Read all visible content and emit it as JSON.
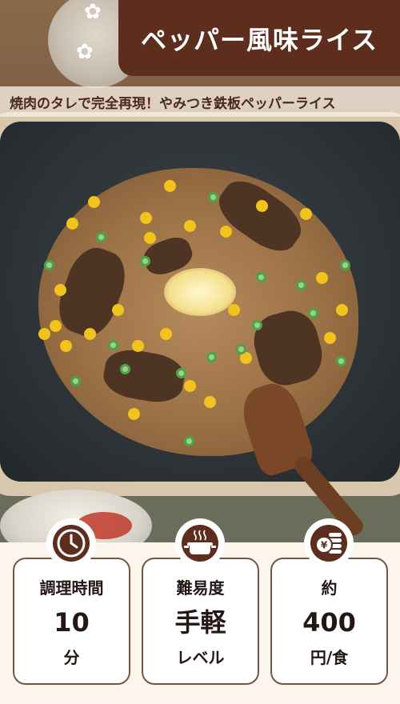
{
  "header": {
    "title": "ペッパー風味ライス",
    "subtitle": "焼肉のタレで完全再現！やみつき鉄板ペッパーライス"
  },
  "info_cards": [
    {
      "icon": "clock-icon",
      "label": "調理時間",
      "value": "10",
      "unit": "分"
    },
    {
      "icon": "cooking-pot-icon",
      "label": "難易度",
      "value": "手軽",
      "unit": "レベル"
    },
    {
      "icon": "coins-icon",
      "label": "約",
      "value": "400",
      "unit": "円/食"
    }
  ],
  "colors": {
    "title_bg": "#5d2e1d",
    "card_border": "#7a5344",
    "text": "#231815",
    "panel_bg": "#fbf5ec"
  }
}
